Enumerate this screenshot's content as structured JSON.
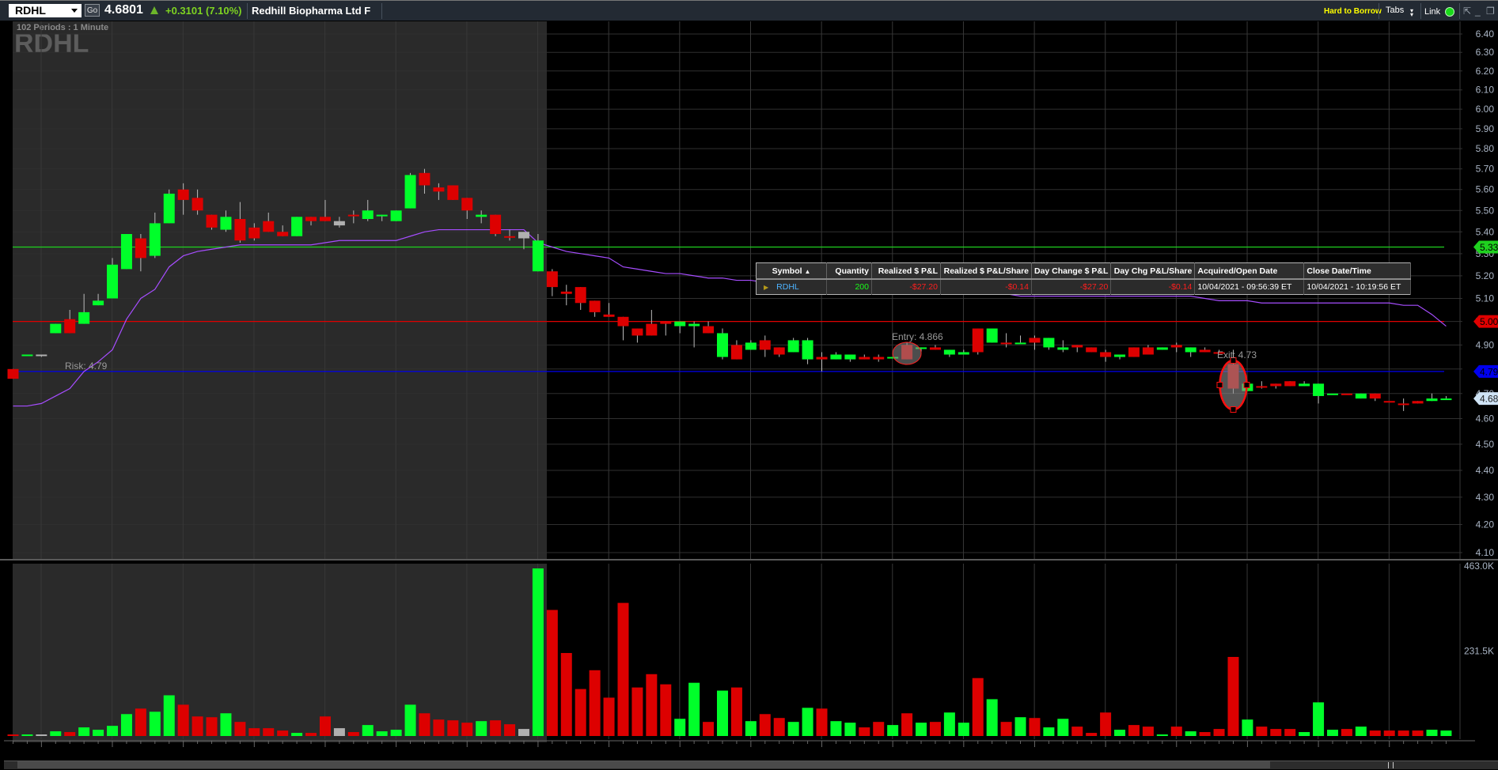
{
  "header": {
    "symbol": "RDHL",
    "go_label": "Go",
    "last_price": "4.6801",
    "change": "+0.3101 (7.10%)",
    "company": "Redhill Biopharma Ltd  F",
    "hard_to_borrow": "Hard to Borrow",
    "tabs_label": "Tabs",
    "link_label": "Link",
    "link_color": "#19d919"
  },
  "chart": {
    "periods_label": "102  Periods : 1 Minute",
    "watermark": "RDHL",
    "colors": {
      "up": "#00ff2a",
      "down": "#dd0000",
      "flat": "#b0b0b0",
      "ma": "#a64dff"
    }
  },
  "chart_data": {
    "type": "candlestick",
    "interval": "1 Minute",
    "y_scale": "log",
    "y_ticks": [
      "6.40",
      "6.30",
      "6.20",
      "6.10",
      "6.00",
      "5.90",
      "5.80",
      "5.70",
      "5.60",
      "5.50",
      "5.40",
      "5.30",
      "5.20",
      "5.10",
      "5.00",
      "4.90",
      "4.80",
      "4.70",
      "4.60",
      "4.50",
      "4.40",
      "4.30",
      "4.20",
      "4.10"
    ],
    "ylim": [
      4.1,
      6.4
    ],
    "candles_ohlc": [
      [
        4.8,
        4.8,
        4.76,
        4.76
      ],
      [
        4.86,
        4.86,
        4.86,
        4.86
      ],
      [
        4.86,
        4.86,
        4.85,
        4.86
      ],
      [
        4.95,
        4.99,
        4.95,
        4.99
      ],
      [
        5.01,
        5.05,
        4.95,
        4.95
      ],
      [
        4.99,
        5.12,
        4.99,
        5.04
      ],
      [
        5.07,
        5.12,
        5.07,
        5.09
      ],
      [
        5.1,
        5.28,
        5.1,
        5.25
      ],
      [
        5.23,
        5.39,
        5.23,
        5.39
      ],
      [
        5.37,
        5.39,
        5.22,
        5.28
      ],
      [
        5.29,
        5.49,
        5.28,
        5.44
      ],
      [
        5.44,
        5.6,
        5.44,
        5.58
      ],
      [
        5.6,
        5.63,
        5.48,
        5.55
      ],
      [
        5.56,
        5.6,
        5.48,
        5.5
      ],
      [
        5.48,
        5.48,
        5.41,
        5.42
      ],
      [
        5.41,
        5.5,
        5.4,
        5.47
      ],
      [
        5.46,
        5.54,
        5.35,
        5.36
      ],
      [
        5.37,
        5.44,
        5.36,
        5.42
      ],
      [
        5.45,
        5.49,
        5.4,
        5.4
      ],
      [
        5.4,
        5.43,
        5.38,
        5.38
      ],
      [
        5.38,
        5.47,
        5.38,
        5.47
      ],
      [
        5.45,
        5.47,
        5.43,
        5.47
      ],
      [
        5.47,
        5.55,
        5.45,
        5.45
      ],
      [
        5.45,
        5.47,
        5.42,
        5.43
      ],
      [
        5.48,
        5.5,
        5.44,
        5.48
      ],
      [
        5.5,
        5.55,
        5.45,
        5.46
      ],
      [
        5.48,
        5.48,
        5.45,
        5.48
      ],
      [
        5.45,
        5.5,
        5.45,
        5.5
      ],
      [
        5.51,
        5.68,
        5.51,
        5.67
      ],
      [
        5.68,
        5.7,
        5.58,
        5.62
      ],
      [
        5.61,
        5.63,
        5.55,
        5.59
      ],
      [
        5.62,
        5.62,
        5.55,
        5.55
      ],
      [
        5.56,
        5.56,
        5.46,
        5.5
      ],
      [
        5.47,
        5.5,
        5.44,
        5.48
      ],
      [
        5.48,
        5.48,
        5.38,
        5.39
      ],
      [
        5.38,
        5.41,
        5.36,
        5.38
      ],
      [
        5.37,
        5.4,
        5.32,
        5.4
      ],
      [
        5.36,
        5.39,
        5.22,
        5.22
      ],
      [
        5.22,
        5.23,
        5.11,
        5.15
      ],
      [
        5.13,
        5.16,
        5.07,
        5.12
      ],
      [
        5.15,
        5.15,
        5.05,
        5.08
      ],
      [
        5.09,
        5.09,
        5.02,
        5.04
      ],
      [
        5.03,
        5.08,
        5.02,
        5.02
      ],
      [
        5.02,
        5.02,
        4.92,
        4.98
      ],
      [
        4.97,
        4.97,
        4.91,
        4.94
      ],
      [
        4.94,
        5.05,
        4.94,
        4.99
      ],
      [
        4.99,
        5.0,
        4.94,
        5.0
      ],
      [
        5.0,
        5.0,
        4.95,
        4.98
      ],
      [
        4.98,
        5.0,
        4.89,
        4.99
      ],
      [
        4.98,
        5.0,
        4.95,
        4.95
      ],
      [
        4.95,
        4.97,
        4.84,
        4.85
      ],
      [
        4.84,
        4.92,
        4.84,
        4.9
      ],
      [
        4.88,
        4.92,
        4.88,
        4.91
      ],
      [
        4.92,
        4.94,
        4.85,
        4.88
      ],
      [
        4.86,
        4.89,
        4.85,
        4.89
      ],
      [
        4.87,
        4.93,
        4.87,
        4.92
      ],
      [
        4.92,
        4.93,
        4.82,
        4.84
      ],
      [
        4.84,
        4.87,
        4.79,
        4.85
      ],
      [
        4.84,
        4.87,
        4.84,
        4.86
      ],
      [
        4.86,
        4.86,
        4.83,
        4.84
      ],
      [
        4.84,
        4.86,
        4.84,
        4.85
      ],
      [
        4.85,
        4.86,
        4.83,
        4.84
      ],
      [
        4.85,
        4.85,
        4.85,
        4.85
      ],
      [
        4.84,
        4.91,
        4.84,
        4.9
      ],
      [
        4.89,
        4.89,
        4.87,
        4.89
      ],
      [
        4.88,
        4.9,
        4.88,
        4.89
      ],
      [
        4.88,
        4.88,
        4.85,
        4.86
      ],
      [
        4.86,
        4.88,
        4.86,
        4.87
      ],
      [
        4.87,
        4.97,
        4.86,
        4.97
      ],
      [
        4.97,
        4.97,
        4.91,
        4.91
      ],
      [
        4.91,
        4.95,
        4.89,
        4.91
      ],
      [
        4.91,
        4.94,
        4.91,
        4.91
      ],
      [
        4.91,
        4.94,
        4.88,
        4.93
      ],
      [
        4.93,
        4.93,
        4.88,
        4.89
      ],
      [
        4.89,
        4.92,
        4.87,
        4.88
      ],
      [
        4.89,
        4.9,
        4.87,
        4.9
      ],
      [
        4.89,
        4.89,
        4.87,
        4.87
      ],
      [
        4.87,
        4.88,
        4.83,
        4.85
      ],
      [
        4.86,
        4.86,
        4.84,
        4.85
      ],
      [
        4.85,
        4.89,
        4.85,
        4.89
      ],
      [
        4.89,
        4.9,
        4.86,
        4.86
      ],
      [
        4.88,
        4.89,
        4.88,
        4.89
      ],
      [
        4.89,
        4.91,
        4.87,
        4.9
      ],
      [
        4.89,
        4.89,
        4.85,
        4.87
      ],
      [
        4.87,
        4.89,
        4.87,
        4.88
      ],
      [
        4.87,
        4.88,
        4.87,
        4.87
      ],
      [
        4.82,
        4.88,
        4.7,
        4.72
      ],
      [
        4.71,
        4.74,
        4.71,
        4.74
      ],
      [
        4.73,
        4.75,
        4.72,
        4.73
      ],
      [
        4.73,
        4.74,
        4.72,
        4.74
      ],
      [
        4.75,
        4.75,
        4.73,
        4.73
      ],
      [
        4.73,
        4.75,
        4.73,
        4.74
      ],
      [
        4.74,
        4.74,
        4.66,
        4.69
      ],
      [
        4.7,
        4.7,
        4.7,
        4.7
      ],
      [
        4.7,
        4.7,
        4.7,
        4.7
      ],
      [
        4.68,
        4.7,
        4.68,
        4.7
      ],
      [
        4.7,
        4.7,
        4.67,
        4.68
      ],
      [
        4.67,
        4.67,
        4.67,
        4.67
      ],
      [
        4.66,
        4.68,
        4.63,
        4.66
      ],
      [
        4.66,
        4.67,
        4.66,
        4.67
      ],
      [
        4.67,
        4.7,
        4.67,
        4.68
      ],
      [
        4.68,
        4.69,
        4.68,
        4.68
      ]
    ],
    "candle_direction": "dunuduuuuduudddudddduddnduuuudddduddnuddddddddduudududduuduuddududuudududuuddduddududdduddduuududddduuduudnuddduuu",
    "pre_market_candles": 38,
    "volume_k": [
      4.3,
      4.3,
      4.3,
      12.8,
      10.7,
      23.5,
      17,
      27.7,
      59.7,
      74.7,
      66.1,
      110.9,
      85.3,
      53.3,
      51.2,
      61.9,
      38.4,
      21.3,
      21.3,
      14.9,
      8.5,
      8.5,
      53.3,
      21.3,
      10.7,
      29.9,
      12.8,
      17.1,
      85.3,
      61.9,
      44.8,
      42.7,
      36.3,
      40.5,
      42.7,
      32,
      19.2,
      456.5,
      343.4,
      226.1,
      128,
      179.2,
      104.5,
      362.6,
      132.2,
      168.5,
      140.8,
      46.9,
      145,
      38.4,
      123.7,
      132.2,
      40.5,
      59.7,
      49.1,
      38.4,
      76.8,
      74.7,
      40.5,
      36.3,
      23.5,
      38.4,
      29.9,
      61.9,
      36.3,
      38.4,
      64,
      36.3,
      157.8,
      100.3,
      38.4,
      51.2,
      49.1,
      23.5,
      46.9,
      25.6,
      8.5,
      64,
      17.1,
      29.9,
      25.6,
      4.3,
      25.6,
      12.8,
      10.7,
      19.2,
      215.4,
      44.8,
      25.6,
      19.2,
      19.2,
      10.7,
      91.7,
      17.1,
      19.2,
      25.6,
      14.9,
      14.9,
      14.9,
      14.9,
      17.1,
      14.9
    ],
    "volume_ticks": [
      "463.0K",
      "231.5K"
    ],
    "volume_max_k": 463.0,
    "moving_average": [
      4.65,
      4.65,
      4.66,
      4.69,
      4.72,
      4.79,
      4.83,
      4.88,
      5.01,
      5.1,
      5.14,
      5.24,
      5.29,
      5.31,
      5.32,
      5.33,
      5.34,
      5.34,
      5.34,
      5.34,
      5.34,
      5.34,
      5.35,
      5.36,
      5.36,
      5.36,
      5.36,
      5.36,
      5.38,
      5.4,
      5.41,
      5.41,
      5.41,
      5.41,
      5.41,
      5.41,
      5.41,
      5.35,
      5.33,
      5.31,
      5.3,
      5.29,
      5.28,
      5.24,
      5.23,
      5.22,
      5.21,
      5.21,
      5.2,
      5.19,
      5.19,
      5.18,
      5.18,
      5.17,
      5.17,
      5.16,
      5.16,
      5.16,
      5.15,
      5.15,
      5.15,
      5.14,
      5.14,
      5.14,
      5.13,
      5.13,
      5.13,
      5.12,
      5.12,
      5.12,
      5.12,
      5.11,
      5.11,
      5.11,
      5.11,
      5.11,
      5.11,
      5.11,
      5.11,
      5.11,
      5.11,
      5.11,
      5.11,
      5.11,
      5.1,
      5.09,
      5.09,
      5.09,
      5.08,
      5.08,
      5.08,
      5.08,
      5.08,
      5.08,
      5.08,
      5.08,
      5.08,
      5.08,
      5.07,
      5.07,
      5.03,
      4.98
    ],
    "levels": [
      {
        "label": "5.33",
        "value": 5.33,
        "color": "#1fd11f"
      },
      {
        "label": "5.00",
        "value": 5.0,
        "color": "#e00000"
      },
      {
        "label": "4.79",
        "value": 4.79,
        "color": "#0000ee"
      }
    ],
    "current_price_tag": {
      "label": "4.680",
      "value": 4.68,
      "color": "#cfe3f5"
    },
    "annotations": {
      "risk": {
        "label": "Risk: 4.79",
        "value": 4.79
      },
      "entry": {
        "label": "Entry: 4.866",
        "value": 4.866,
        "candle": 63
      },
      "exit": {
        "label": "Exit: 4.73",
        "value": 4.73,
        "candle": 86
      }
    }
  },
  "positions_table": {
    "columns": [
      "Symbol",
      "Quantity",
      "Realized $ P&L",
      "Realized $ P&L/Share",
      "Day Change $ P&L",
      "Day Chg P&L/Share",
      "Acquired/Open Date",
      "Close Date/Time"
    ],
    "sort_indicator": "▲",
    "rows": [
      {
        "symbol": "RDHL",
        "quantity": "200",
        "realized_pl": "-$27.20",
        "realized_pl_share": "-$0.14",
        "day_change_pl": "-$27.20",
        "day_chg_pl_share": "-$0.14",
        "open_date": "10/04/2021 - 09:56:39 ET",
        "close_date": "10/04/2021 - 10:19:56 ET"
      }
    ]
  }
}
